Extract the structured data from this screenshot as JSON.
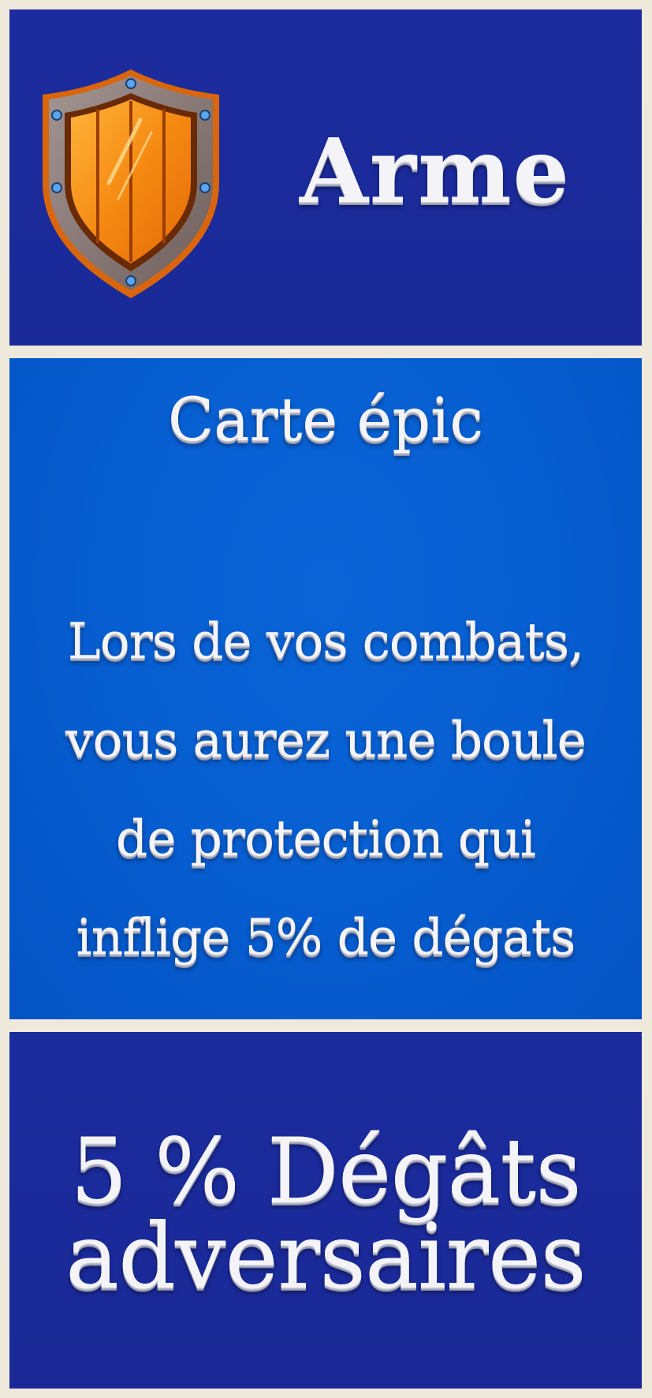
{
  "card": {
    "icon": "shield-icon",
    "title": "Arme",
    "rarity": "Carte épic",
    "description_lines": [
      "Lors de vos combats,",
      "vous aurez une boule",
      "de protection qui",
      "inflige 5% de dégats"
    ],
    "stat_lines": [
      "5 % Dégâts",
      "adversaires"
    ]
  },
  "colors": {
    "frame": "#efe9dc",
    "panel_dark_blue": "#1c2c9e",
    "panel_bright_blue": "#0a64d6",
    "text": "#f4f4f8",
    "shield_orange": "#f58a12",
    "shield_rim": "#7a6a66"
  }
}
